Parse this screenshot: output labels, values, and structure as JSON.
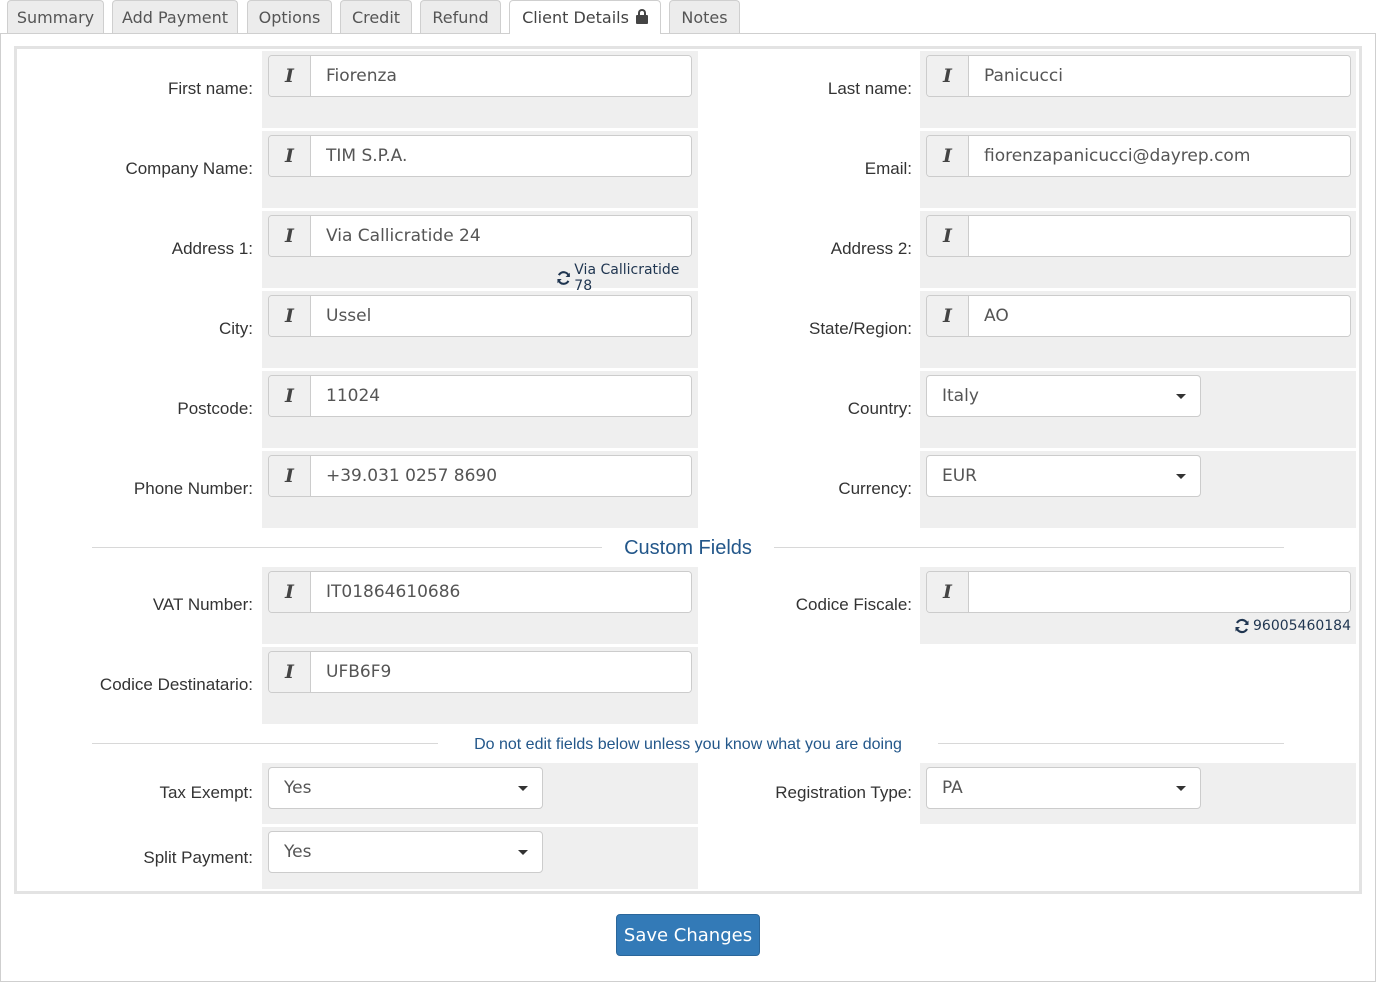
{
  "tabs": [
    {
      "label": "Summary"
    },
    {
      "label": "Add Payment"
    },
    {
      "label": "Options"
    },
    {
      "label": "Credit"
    },
    {
      "label": "Refund"
    },
    {
      "label": "Client Details"
    },
    {
      "label": "Notes"
    }
  ],
  "active_tab": "Client Details",
  "addon_glyph": "I",
  "fields": {
    "first_name": {
      "label": "First name:",
      "value": "Fiorenza"
    },
    "last_name": {
      "label": "Last name:",
      "value": "Panicucci"
    },
    "company_name": {
      "label": "Company Name:",
      "value": "TIM S.P.A."
    },
    "email": {
      "label": "Email:",
      "value": "fiorenzapanicucci@dayrep.com"
    },
    "address1": {
      "label": "Address 1:",
      "value": "Via Callicratide 24",
      "suggestion": "Via Callicratide 78"
    },
    "address2": {
      "label": "Address 2:",
      "value": ""
    },
    "city": {
      "label": "City:",
      "value": "Ussel"
    },
    "state": {
      "label": "State/Region:",
      "value": "AO"
    },
    "postcode": {
      "label": "Postcode:",
      "value": "11024"
    },
    "country": {
      "label": "Country:",
      "value": "Italy"
    },
    "phone": {
      "label": "Phone Number:",
      "value": "+39.031 0257 8690"
    },
    "currency": {
      "label": "Currency:",
      "value": "EUR"
    }
  },
  "custom_fields": {
    "title": "Custom Fields",
    "vat_number": {
      "label": "VAT Number:",
      "value": "IT01864610686"
    },
    "codice_fiscale": {
      "label": "Codice Fiscale:",
      "value": "",
      "suggestion": "96005460184"
    },
    "codice_destinatario": {
      "label": "Codice Destinatario:",
      "value": "UFB6F9"
    }
  },
  "advanced": {
    "warning": "Do not edit fields below unless you know what you are doing",
    "tax_exempt": {
      "label": "Tax Exempt:",
      "value": "Yes"
    },
    "registration_type": {
      "label": "Registration Type:",
      "value": "PA"
    },
    "split_payment": {
      "label": "Split Payment:",
      "value": "Yes"
    }
  },
  "save_label": "Save Changes",
  "colors": {
    "accent": "#337ab7",
    "section_title": "#23578a",
    "field_bg": "#efefef"
  },
  "icons": {
    "addon": "text-cursor-icon",
    "lock": "lock-icon",
    "refresh": "refresh-icon",
    "caret": "caret-down-icon"
  }
}
